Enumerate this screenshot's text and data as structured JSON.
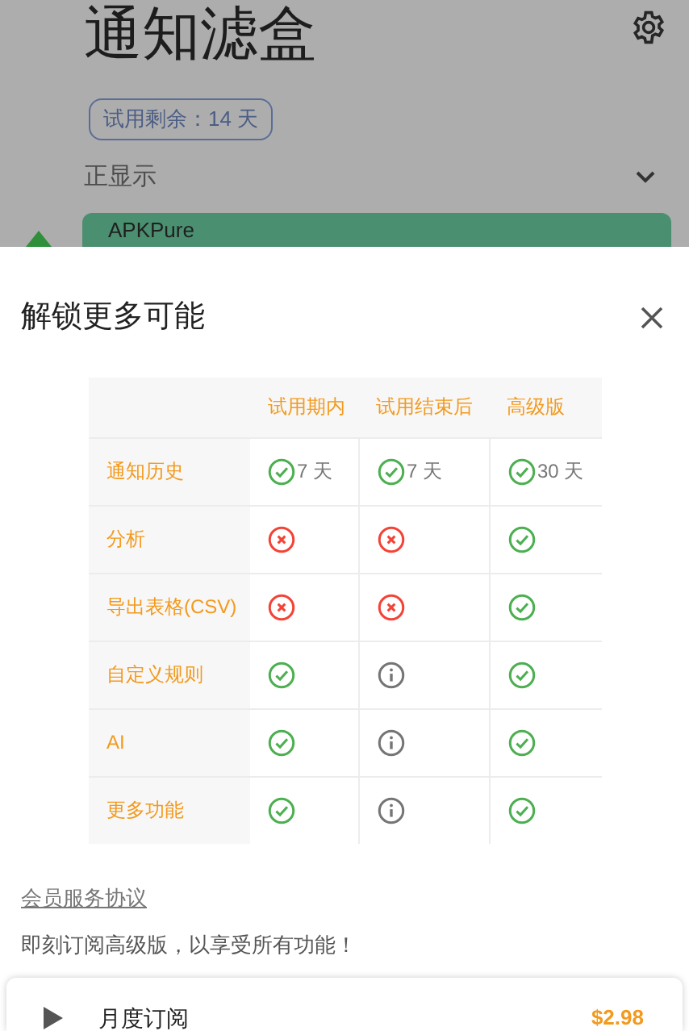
{
  "background": {
    "title": "通知滤盒",
    "trial_badge": "试用剩余：14 天",
    "section": {
      "label": "正显示",
      "expanded": false
    },
    "app_card": {
      "name": "APKPure"
    }
  },
  "sheet": {
    "title": "解锁更多可能",
    "table": {
      "columns": [
        "试用期内",
        "试用结束后",
        "高级版"
      ],
      "rows": [
        {
          "label": "通知历史",
          "cells": [
            {
              "kind": "yes",
              "text": "7 天"
            },
            {
              "kind": "yes",
              "text": "7 天"
            },
            {
              "kind": "yes",
              "text": "30 天"
            }
          ]
        },
        {
          "label": "分析",
          "cells": [
            {
              "kind": "no"
            },
            {
              "kind": "no"
            },
            {
              "kind": "yes"
            }
          ]
        },
        {
          "label": "导出表格(CSV)",
          "cells": [
            {
              "kind": "no"
            },
            {
              "kind": "no"
            },
            {
              "kind": "yes"
            }
          ]
        },
        {
          "label": "自定义规则",
          "cells": [
            {
              "kind": "yes"
            },
            {
              "kind": "info"
            },
            {
              "kind": "yes"
            }
          ]
        },
        {
          "label": "AI",
          "cells": [
            {
              "kind": "yes"
            },
            {
              "kind": "info"
            },
            {
              "kind": "yes"
            }
          ]
        },
        {
          "label": "更多功能",
          "cells": [
            {
              "kind": "yes"
            },
            {
              "kind": "info"
            },
            {
              "kind": "yes"
            }
          ]
        }
      ]
    },
    "agreement_link": "会员服务协议",
    "pitch": "即刻订阅高级版，以享受所有功能！",
    "plan": {
      "name": "月度订阅",
      "price": "$2.98"
    }
  }
}
